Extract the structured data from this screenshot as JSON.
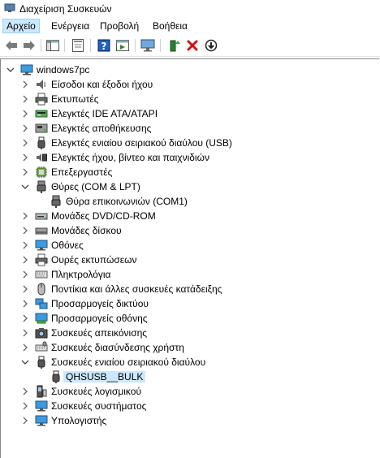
{
  "window": {
    "title": "Διαχείριση Συσκευών"
  },
  "menu": [
    "Αρχείο",
    "Ενέργεια",
    "Προβολή",
    "Βοήθεια"
  ],
  "toolbar": [
    "back-icon",
    "forward-icon",
    "show-hide-tree-icon",
    "properties-icon",
    "help-icon",
    "action-pane-icon",
    "scan-hardware-icon",
    "update-driver-icon",
    "uninstall-icon",
    "disable-icon"
  ],
  "tree": {
    "root": "windows7pc",
    "items": [
      {
        "label": "Είσοδοι και έξοδοι ήχου",
        "icon": "speaker-icon",
        "expanded": false
      },
      {
        "label": "Εκτυπωτές",
        "icon": "printer-icon",
        "expanded": false
      },
      {
        "label": "Ελεγκτές IDE ATA/ATAPI",
        "icon": "ide-controller-icon",
        "expanded": false
      },
      {
        "label": "Ελεγκτές αποθήκευσης",
        "icon": "storage-controller-icon",
        "expanded": false
      },
      {
        "label": "Ελεγκτές ενιαίου σειριακού διαύλου (USB)",
        "icon": "usb-icon",
        "expanded": false
      },
      {
        "label": "Ελεγκτές ήχου, βίντεο και παιχνιδιών",
        "icon": "sound-video-icon",
        "expanded": false
      },
      {
        "label": "Επεξεργαστές",
        "icon": "processor-icon",
        "expanded": false
      },
      {
        "label": "Θύρες (COM & LPT)",
        "icon": "port-icon",
        "expanded": true,
        "children": [
          {
            "label": "Θύρα επικοινωνιών (COM1)",
            "icon": "port-icon"
          }
        ]
      },
      {
        "label": "Μονάδες DVD/CD-ROM",
        "icon": "dvd-icon",
        "expanded": false
      },
      {
        "label": "Μονάδες δίσκου",
        "icon": "disk-icon",
        "expanded": false
      },
      {
        "label": "Οθόνες",
        "icon": "monitor-icon",
        "expanded": false
      },
      {
        "label": "Ουρές εκτυπώσεων",
        "icon": "printer-icon",
        "expanded": false
      },
      {
        "label": "Πληκτρολόγια",
        "icon": "keyboard-icon",
        "expanded": false
      },
      {
        "label": "Ποντίκια και άλλες συσκευές κατάδειξης",
        "icon": "mouse-icon",
        "expanded": false
      },
      {
        "label": "Προσαρμογείς δικτύου",
        "icon": "network-adapter-icon",
        "expanded": false
      },
      {
        "label": "Προσαρμογείς οθόνης",
        "icon": "display-adapter-icon",
        "expanded": false
      },
      {
        "label": "Συσκευές απεικόνισης",
        "icon": "imaging-icon",
        "expanded": false
      },
      {
        "label": "Συσκευές διασύνδεσης χρήστη",
        "icon": "hid-icon",
        "expanded": false
      },
      {
        "label": "Συσκευές ενιαίου σειριακού διαύλου",
        "icon": "usb-icon",
        "expanded": true,
        "children": [
          {
            "label": "QHSUSB__BULK",
            "icon": "usb-icon",
            "selected": true
          }
        ]
      },
      {
        "label": "Συσκευές λογισμικού",
        "icon": "software-device-icon",
        "expanded": false
      },
      {
        "label": "Συσκευές συστήματος",
        "icon": "system-device-icon",
        "expanded": false
      },
      {
        "label": "Υπολογιστής",
        "icon": "computer-icon",
        "expanded": false
      }
    ]
  }
}
